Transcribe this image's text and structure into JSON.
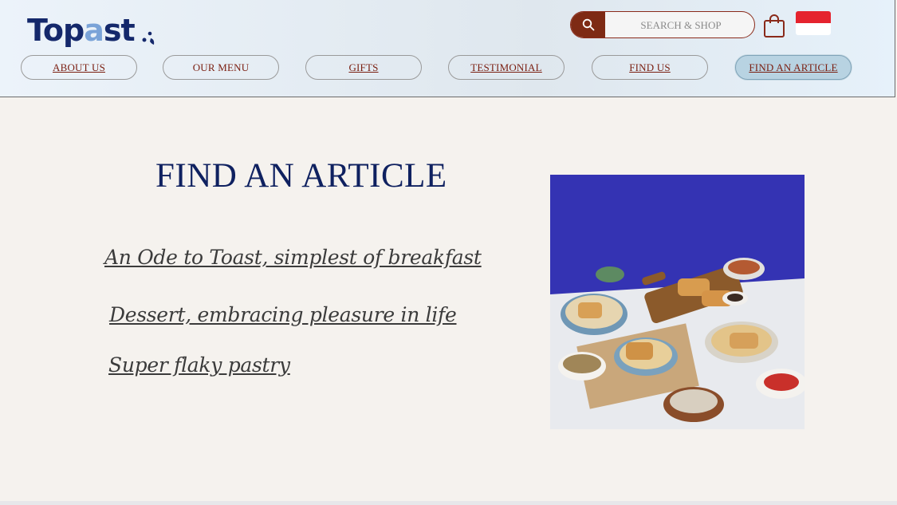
{
  "brand": {
    "logo_text_main": "Top",
    "logo_text_accent": "a",
    "logo_text_end": "st"
  },
  "search": {
    "placeholder": "SEARCH & SHOP"
  },
  "nav": {
    "items": [
      {
        "label": "ABOUT US"
      },
      {
        "label": "OUR MENU"
      },
      {
        "label": "GIFTS"
      },
      {
        "label": "TESTIMONIAL"
      },
      {
        "label": "FIND US"
      },
      {
        "label": "FIND AN ARTICLE"
      }
    ]
  },
  "main": {
    "title": "FIND AN ARTICLE",
    "articles": [
      {
        "label": "An Ode to Toast, simplest of breakfast"
      },
      {
        "label": "Dessert, embracing pleasure in life"
      },
      {
        "label": "Super flaky pastry"
      }
    ]
  },
  "colors": {
    "brand_navy": "#14286b",
    "accent_blue": "#7aa3d8",
    "nav_text": "#7a1e10",
    "search_red": "#7e2a14",
    "active_nav": "#b8d3e2",
    "page_bg": "#f5f2ee"
  },
  "icons": [
    "search-icon",
    "shopping-bag-icon",
    "language-flag-icon"
  ]
}
